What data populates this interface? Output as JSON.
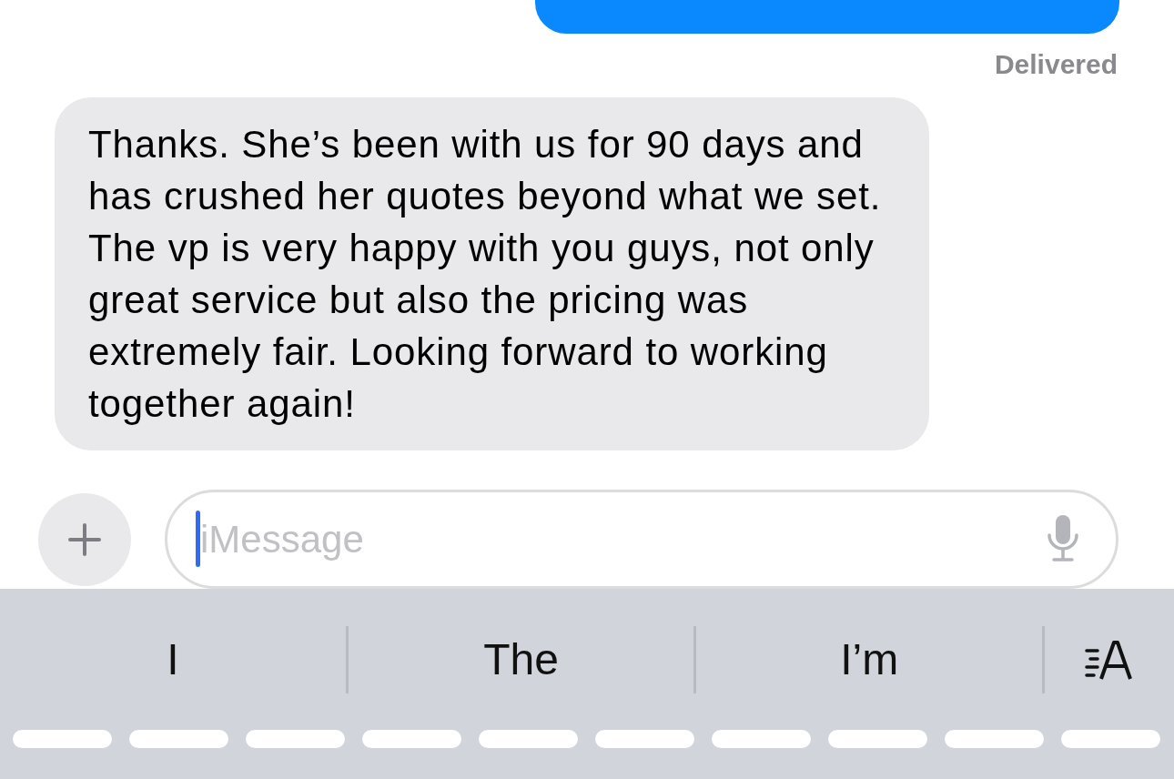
{
  "messages": [
    {
      "kind": "sent"
    },
    {
      "kind": "status",
      "text": "Delivered"
    },
    {
      "kind": "received",
      "text": "Thanks. She’s been with us for 90 days and has crushed her quotes beyond what we set. The vp is very happy with you guys, not only great service but also the pricing was extremely fair. Looking forward to working together again!"
    }
  ],
  "composer": {
    "placeholder": "iMessage",
    "focused": true
  },
  "suggestions": [
    "I",
    "The",
    "I’m"
  ]
}
